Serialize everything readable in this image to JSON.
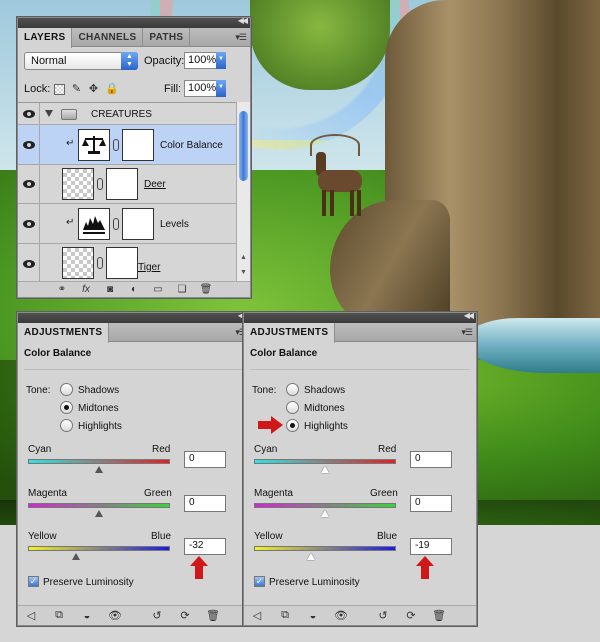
{
  "layers_panel": {
    "tabs": [
      "LAYERS",
      "CHANNELS",
      "PATHS"
    ],
    "blend_mode": "Normal",
    "opacity_label": "Opacity:",
    "opacity_value": "100%",
    "lock_label": "Lock:",
    "fill_label": "Fill:",
    "fill_value": "100%",
    "layers": [
      {
        "name": "CREATURES",
        "type": "group"
      },
      {
        "name": "Color Balance",
        "type": "adjustment",
        "selected": true
      },
      {
        "name": "Deer",
        "type": "pixel"
      },
      {
        "name": "Levels",
        "type": "adjustment"
      },
      {
        "name": "Tiger",
        "type": "pixel"
      }
    ],
    "bottom_icons": [
      "link-icon",
      "fx-icon",
      "mask-icon",
      "adjustment-icon",
      "folder-icon",
      "new-layer-icon",
      "trash-icon"
    ],
    "fx_label": "fx"
  },
  "adjustments_left": {
    "tab": "ADJUSTMENTS",
    "title": "Color Balance",
    "tone_label": "Tone:",
    "tones": [
      "Shadows",
      "Midtones",
      "Highlights"
    ],
    "selected_tone": "Midtones",
    "sliders": [
      {
        "left": "Cyan",
        "right": "Red",
        "value": "0"
      },
      {
        "left": "Magenta",
        "right": "Green",
        "value": "0"
      },
      {
        "left": "Yellow",
        "right": "Blue",
        "value": "-32"
      }
    ],
    "preserve_label": "Preserve Luminosity"
  },
  "adjustments_right": {
    "tab": "ADJUSTMENTS",
    "title": "Color Balance",
    "tone_label": "Tone:",
    "tones": [
      "Shadows",
      "Midtones",
      "Highlights"
    ],
    "selected_tone": "Highlights",
    "sliders": [
      {
        "left": "Cyan",
        "right": "Red",
        "value": "0"
      },
      {
        "left": "Magenta",
        "right": "Green",
        "value": "0"
      },
      {
        "left": "Yellow",
        "right": "Blue",
        "value": "-19"
      }
    ],
    "preserve_label": "Preserve Luminosity"
  },
  "colors": {
    "annotation_arrow": "#d01818",
    "selection": "#bcd3f5",
    "panel_bg": "#d4d4d4"
  }
}
